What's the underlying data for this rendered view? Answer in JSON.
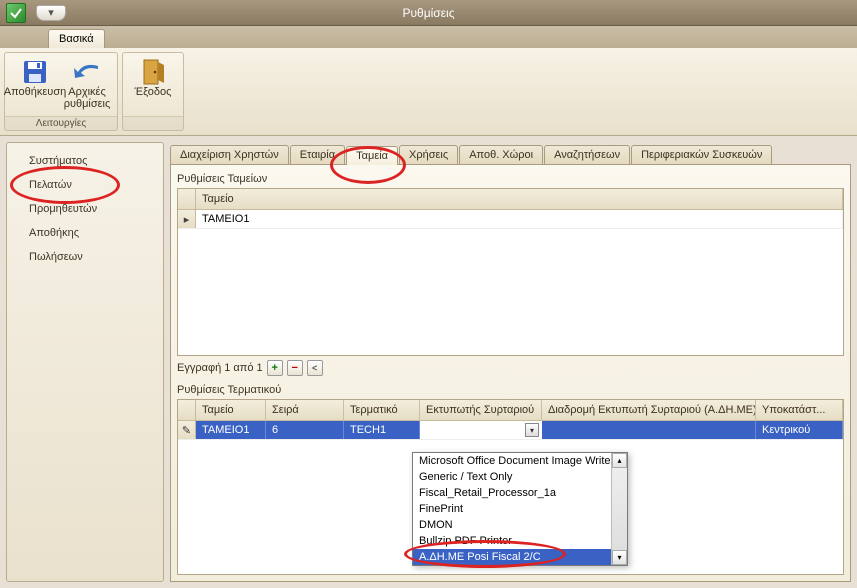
{
  "window": {
    "title": "Ρυθμίσεις"
  },
  "ribbon": {
    "tab": "Βασικά",
    "group_caption": "Λειτουργίες",
    "save": "Αποθήκευση",
    "defaults_l1": "Αρχικές",
    "defaults_l2": "ρυθμίσεις",
    "exit": "Έξοδος"
  },
  "sidebar": {
    "items": [
      {
        "label": "Συστήματος"
      },
      {
        "label": "Πελατών"
      },
      {
        "label": "Προμηθευτών"
      },
      {
        "label": "Αποθήκης"
      },
      {
        "label": "Πωλήσεων"
      }
    ]
  },
  "tabs": [
    {
      "label": "Διαχείριση Χρηστών"
    },
    {
      "label": "Εταιρία"
    },
    {
      "label": "Ταμεία"
    },
    {
      "label": "Χρήσεις"
    },
    {
      "label": "Αποθ. Χώροι"
    },
    {
      "label": "Αναζητήσεων"
    },
    {
      "label": "Περιφεριακών Συσκευών"
    }
  ],
  "top_section": {
    "title": "Ρυθμίσεις Ταμείων",
    "col_tameio": "Ταμείο",
    "rows": [
      {
        "tameio": "TAMEIO1"
      }
    ]
  },
  "navigator": {
    "text": "Εγγραφή 1 από 1"
  },
  "bottom_section": {
    "title": "Ρυθμίσεις Τερματικού",
    "cols": {
      "tameio": "Ταμείο",
      "seira": "Σειρά",
      "terminal": "Τερματικό",
      "drawer_printer": "Εκτυπωτής Συρταριού",
      "drawer_path": "Διαδρομή Εκτυπωτή Συρταριού (Α.ΔΗ.ΜΕ)",
      "store": "Υποκατάστ..."
    },
    "row": {
      "tameio": "TAMEIO1",
      "seira": "6",
      "terminal": "TECH1",
      "drawer_printer": "",
      "store": "Κεντρικού"
    }
  },
  "dropdown": {
    "options": [
      "Microsoft Office Document Image Writer",
      "Generic / Text Only",
      "Fiscal_Retail_Processor_1a",
      "FinePrint",
      "DMON",
      "Bullzip PDF Printer",
      "Α.ΔΗ.ΜΕ Posi Fiscal 2/C"
    ],
    "selected_index": 6
  }
}
